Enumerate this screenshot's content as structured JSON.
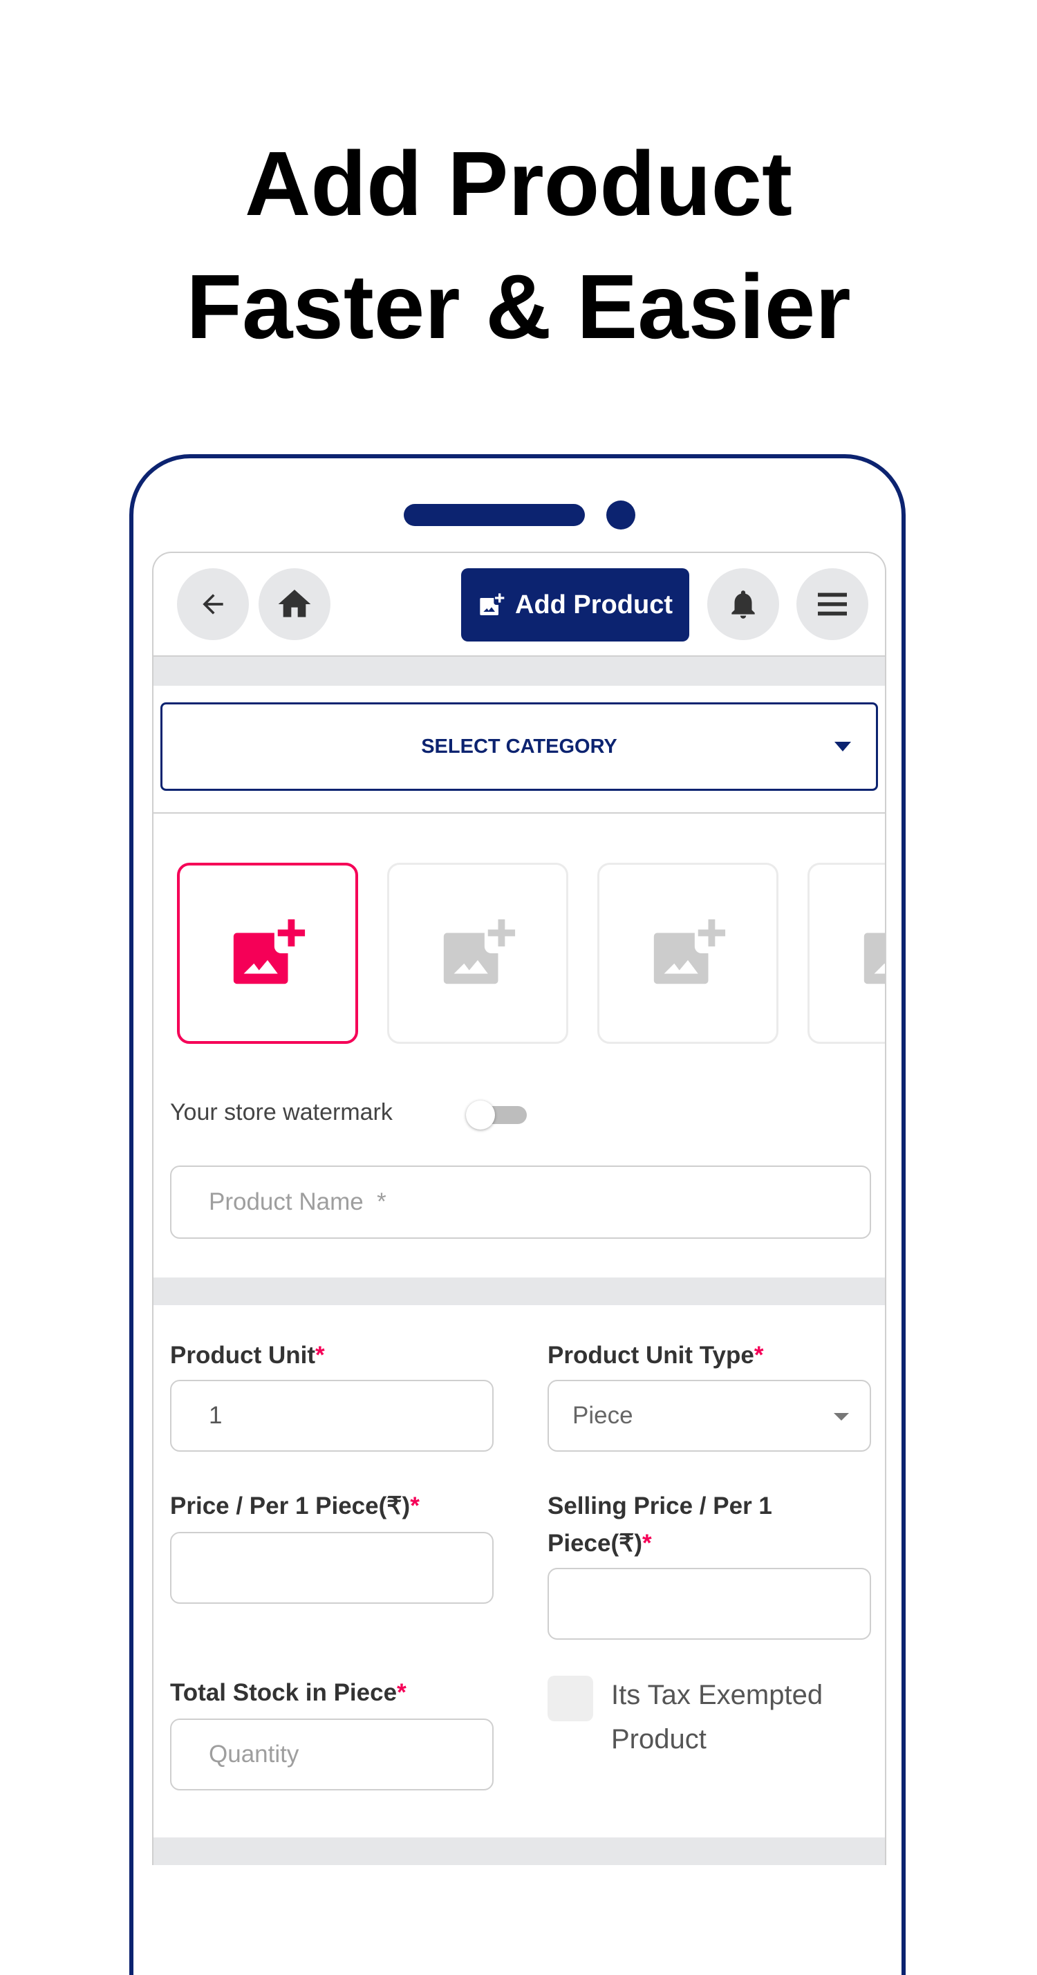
{
  "promo": {
    "headline_line1": "Add Product",
    "headline_line2": "Faster & Easier"
  },
  "colors": {
    "brand_navy": "#0c2370",
    "accent_pink": "#f50057",
    "band_gray": "#e6e7e9"
  },
  "topbar": {
    "back_icon": "arrow-left-icon",
    "home_icon": "home-icon",
    "add_product_label": "Add Product",
    "add_product_icon": "add-photo-icon",
    "notification_icon": "bell-icon",
    "menu_icon": "hamburger-menu-icon"
  },
  "category": {
    "label": "SELECT CATEGORY",
    "icon": "caret-down-icon"
  },
  "images": {
    "slots": [
      {
        "state": "active",
        "icon": "add-photo-icon"
      },
      {
        "state": "inactive",
        "icon": "add-photo-icon"
      },
      {
        "state": "inactive",
        "icon": "add-photo-icon"
      },
      {
        "state": "inactive",
        "icon": "add-photo-icon"
      }
    ]
  },
  "watermark": {
    "label": "Your store watermark",
    "enabled": false
  },
  "product_name": {
    "placeholder": "Product Name  *"
  },
  "form": {
    "product_unit": {
      "label": "Product Unit",
      "required": "*",
      "value": "1"
    },
    "product_unit_type": {
      "label": "Product Unit Type",
      "required": "*",
      "value": "Piece"
    },
    "price": {
      "label": "Price / Per 1 Piece(₹)",
      "required": "*",
      "value": ""
    },
    "selling_price": {
      "label_line1": "Selling Price / Per 1",
      "label_line2": "Piece(₹)",
      "required": "*",
      "value": ""
    },
    "total_stock": {
      "label": "Total Stock in Piece",
      "required": "*",
      "placeholder": "Quantity"
    },
    "tax_exempt": {
      "label": "Its Tax Exempted Product",
      "checked": false
    }
  }
}
